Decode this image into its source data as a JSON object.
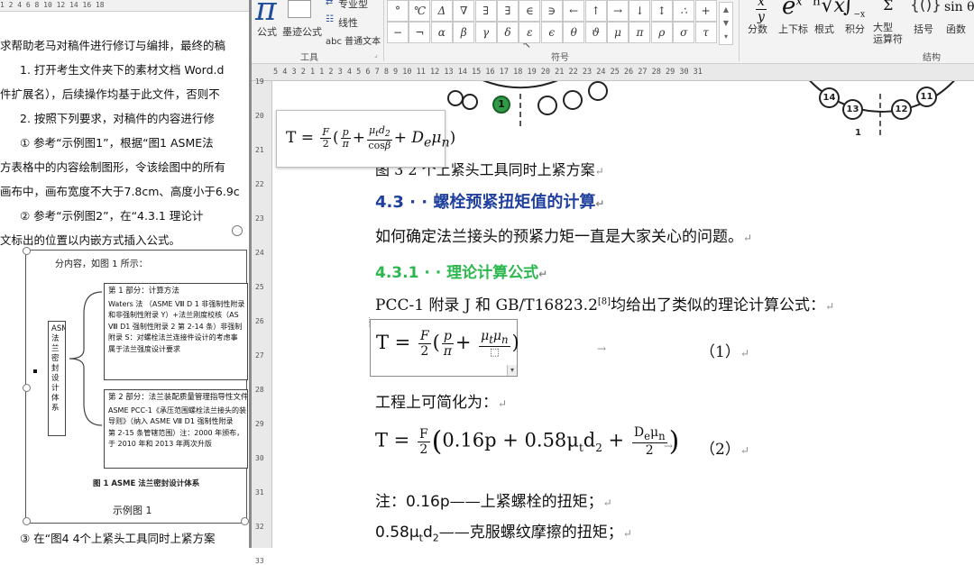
{
  "left_doc": {
    "lines": [
      "求帮助老马对稿件进行修订与编排，最终的稿",
      "1.  打开考生文件夹下的素材文档 Word.d",
      "件扩展名），后续操作均基于此文件，否则不",
      "2.  按照下列要求，对稿件的内容进行修",
      "①  参考“示例图1”，根据“图1 ASME法",
      "方表格中的内容绘制图形，令该绘图中的所有",
      "画布中，画布宽度不大于7.8cm、高度小于6.9c",
      "②  参考“示例图2”，在“4.3.1 理论计",
      "文标出的位置以内嵌方式插入公式。"
    ],
    "fig_intro": "分内容，如图 1 所示：",
    "vertical_box": "ASME 法兰密封设计体系",
    "box1_title": "第 1 部分：计算方法",
    "box1_lines": [
      "Waters 法 （ASME Ⅷ D 1 非强制性附录",
      "和非强制性附录 Y）+法兰刚度校核（AS",
      "Ⅷ D1 强制性附录 2 第 2-14 条）非强制",
      "附录 S：对螺栓法兰连接件设计的考虑事",
      "属于法兰强度设计要求"
    ],
    "box2_title": "第 2 部分：法兰装配质量管理指导性文件",
    "box2_lines": [
      "ASME PCC-1《承压范围螺栓法兰接头的装",
      "导则》（纳入 ASME Ⅷ D1 强制性附录",
      "第 2-15 条管辖范围）注：2000 年颁布，",
      "于 2010 年和 2013 年两次升版"
    ],
    "fig_caption": "图 1  ASME 法兰密封设计体系",
    "example_caption": "示例图 1",
    "bottom_line": "③  在“图4 4个上紧头工具同时上紧方案"
  },
  "ribbon": {
    "tools_group": "工具",
    "symbols_group": "符号",
    "structures_group": "结构",
    "equation_label": "公式",
    "ink_equation_label": "墨迹公式",
    "professional_label": "专业型",
    "linear_label": "线性",
    "normal_text_label": "普通文本",
    "symbols_row1": [
      "°",
      "℃",
      "Δ",
      "∇",
      "∃",
      "∃",
      "∈",
      "∋",
      "←",
      "↑",
      "→",
      "↓",
      "↕",
      "∴",
      "+"
    ],
    "symbols_row2": [
      "−",
      "¬",
      "α",
      "β",
      "γ",
      "δ",
      "ε",
      "ϵ",
      "θ",
      "ϑ",
      "μ",
      "π",
      "ρ",
      "σ",
      "τ"
    ],
    "structures": [
      "分数",
      "上下标",
      "根式",
      "积分",
      "大型\n运算符",
      "括号",
      "函数"
    ]
  },
  "ruler_text": "5 4 3 2 1   1 2 3 4 5 6 7 8 9 10 11 12 13 14 15 16 17 18 19 20 21 22 23 24 25 26 27 28 29 30 31",
  "left_ruler_text": "1 2 4 6 8 10 12 14 16 18",
  "vruler_numbers": [
    "19",
    "20",
    "21",
    "22",
    "23",
    "24",
    "25",
    "26",
    "27",
    "28",
    "29",
    "30",
    "31",
    "32",
    "33"
  ],
  "diagram": {
    "left_circle_numbers": [
      "1"
    ],
    "right_circle_numbers": [
      "14",
      "13",
      "12",
      "11"
    ],
    "bottom_label": "1"
  },
  "main_doc": {
    "figure_caption": "图 3  2 个上紧头工具同时上紧方案",
    "section_heading": "4.3 · · 螺栓预紧扭矩值的计算",
    "para1": "如何确定法兰接头的预紧力矩一直是大家关心的问题。",
    "subsection_heading": "4.3.1 · · 理论计算公式",
    "para2_before": "PCC-1 附录 J 和 GB/T16823.2",
    "para2_ref": "[8]",
    "para2_after": "均给出了类似的理论计算公式：",
    "eq1_number": "（1）",
    "para3": "工程上可简化为：",
    "eq2_number": "（2）",
    "note1_math": "0.16p",
    "note1_text": "——上紧螺栓的扭矩；",
    "note_prefix": "注：",
    "note2_math": "0.58μ",
    "note2_text": "——克服螺纹摩擦的扭矩；"
  },
  "colors": {
    "heading_blue": "#1f3f9e",
    "heading_green": "#2cb84e",
    "green_circle": "#2e9b45"
  }
}
